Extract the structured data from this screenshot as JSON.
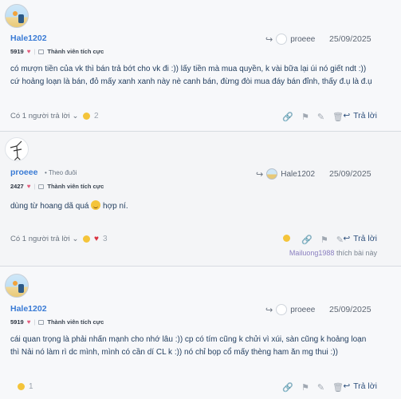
{
  "posts": [
    {
      "username": "Hale1202",
      "score": "5919",
      "rank": "Thành viên tích cực",
      "reply_to_user": "proeee",
      "date": "25/09/2025",
      "lines": [
        "có mượn tiền của vk thì bán trả bớt cho vk đi :)) lấy tiền mà mua quyền, k vài bữa lại úi nó giết ndt :))",
        "cứ hoảng loạn là bán, đỏ mấy xanh xanh này nè canh bán, đừng đòi mua đáy bán đỉnh, thấy đ.ụ là đ.ụ"
      ],
      "replies_label": "Có 1 người trả lời",
      "reaction_count": "2",
      "reply_label": "Trả lời"
    },
    {
      "username": "proeee",
      "follow": "Theo đuôi",
      "score": "2427",
      "rank": "Thành viên tích cực",
      "reply_to_user": "Hale1202",
      "date": "25/09/2025",
      "text_before": "dùng từ hoang dã quá",
      "text_after": "hợp ní.",
      "replies_label": "Có 1 người trả lời",
      "reaction_count": "3",
      "reply_label": "Trả lời",
      "liked_by": "Mailuong1988",
      "liked_suffix": "thích bài này"
    },
    {
      "username": "Hale1202",
      "score": "5919",
      "rank": "Thành viên tích cực",
      "reply_to_user": "proeee",
      "date": "25/09/2025",
      "lines": [
        "cái quan trọng là phải nhấn mạnh cho nhớ lâu :)) cp có tím cũng k chửi vì xúi, sàn cũng k hoảng loạn",
        "thì Nải nó làm rì dc mình, mình có cần dí CL k :)) nó chỉ bọp cổ mấy thèng ham ăn mg thui :))"
      ],
      "reaction_count": "1",
      "reply_label": "Trả lời"
    }
  ],
  "colors": {
    "username": "#3a7bd5",
    "content": "#1f3b5c",
    "accent": "#2d4f7c"
  }
}
